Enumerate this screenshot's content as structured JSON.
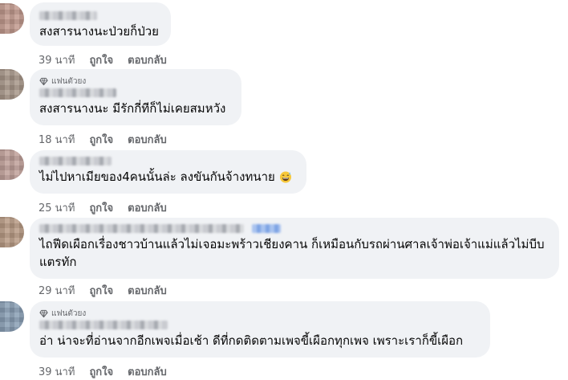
{
  "comments": [
    {
      "badge": "",
      "text": "สงสารนางนะป่วยก็ป่วย",
      "time": "39 นาที",
      "like": "ถูกใจ",
      "reply": "ตอบกลับ"
    },
    {
      "badge": "แฟนตัวยง",
      "text": "สงสารนางนะ มีรักกี่ทีก็ไม่เคยสมหวัง",
      "time": "18 นาที",
      "like": "ถูกใจ",
      "reply": "ตอบกลับ"
    },
    {
      "badge": "",
      "text": "ไม่ไปหาเมียของ4คนนั้นล่ะ ลงขันกันจ้างทนาย",
      "emoji": "grinning-sweat-face",
      "time": "25 นาที",
      "like": "ถูกใจ",
      "reply": "ตอบกลับ"
    },
    {
      "badge": "",
      "text": "ไถฟีดเผือกเรื่องชาวบ้านแล้วไม่เจอมะพร้าวเชียงคาน ก็เหมือนกับรถผ่านศาลเจ้าพ่อเจ้าแม่แล้วไม่บีบแตรทัก",
      "time": "29 นาที",
      "like": "ถูกใจ",
      "reply": "ตอบกลับ"
    },
    {
      "badge": "แฟนตัวยง",
      "text": "อ่า น่าจะที่อ่านจากอีกเพจเมื่อเช้า ดีที่กดติดตามเพจขี้เผือกทุกเพจ เพราะเราก็ขี้เผือก",
      "time": "39 นาที",
      "like": "ถูกใจ",
      "reply": "ตอบกลับ"
    }
  ],
  "colors": {
    "bubble": "#f0f2f5",
    "text": "#050505",
    "meta": "#65676b"
  },
  "icons": [
    "diamond-icon",
    "grinning-sweat-emoji"
  ]
}
